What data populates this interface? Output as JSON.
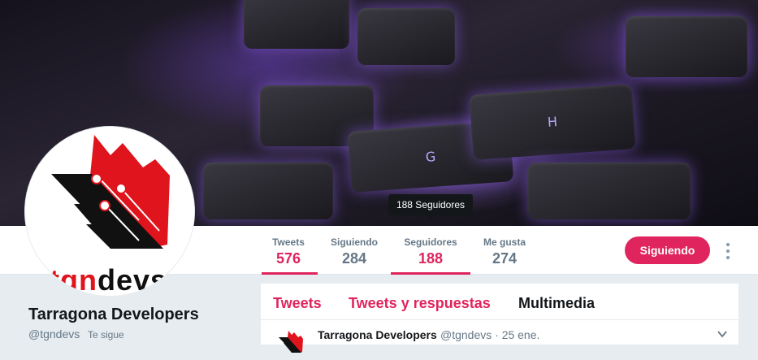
{
  "tooltip": {
    "text": "188 Seguidores"
  },
  "banner": {
    "key_g": "G",
    "key_h": "H"
  },
  "stats": [
    {
      "label": "Tweets",
      "value": "576"
    },
    {
      "label": "Siguiendo",
      "value": "284"
    },
    {
      "label": "Seguidores",
      "value": "188"
    },
    {
      "label": "Me gusta",
      "value": "274"
    }
  ],
  "follow_button": {
    "label": "Siguiendo"
  },
  "profile": {
    "name": "Tarragona Developers",
    "handle": "@tgndevs",
    "follows_you": "Te sigue",
    "logo_text": "tgndevs"
  },
  "timeline": {
    "tabs": [
      {
        "label": "Tweets"
      },
      {
        "label": "Tweets y respuestas"
      },
      {
        "label": "Multimedia"
      }
    ],
    "tweet": {
      "author": "Tarragona Developers",
      "meta": "@tgndevs · 25 ene."
    }
  },
  "colors": {
    "accent": "#e0245e",
    "text_secondary": "#657786",
    "logo_red": "#e0141c"
  },
  "icons": [
    "more-vertical-icon",
    "chevron-down-icon"
  ]
}
